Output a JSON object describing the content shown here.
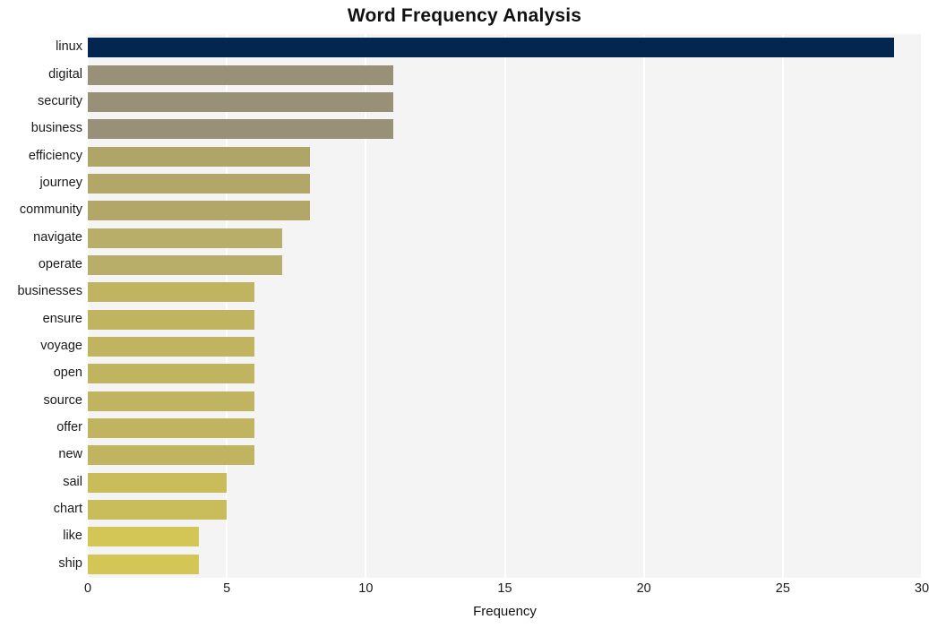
{
  "chart_data": {
    "type": "bar",
    "orientation": "horizontal",
    "title": "Word Frequency Analysis",
    "xlabel": "Frequency",
    "ylabel": "",
    "categories": [
      "linux",
      "digital",
      "security",
      "business",
      "efficiency",
      "journey",
      "community",
      "navigate",
      "operate",
      "businesses",
      "ensure",
      "voyage",
      "open",
      "source",
      "offer",
      "new",
      "sail",
      "chart",
      "like",
      "ship"
    ],
    "values": [
      29,
      11,
      11,
      11,
      8,
      8,
      8,
      7,
      7,
      6,
      6,
      6,
      6,
      6,
      6,
      6,
      5,
      5,
      4,
      4
    ],
    "bar_colors": [
      "#032650",
      "#999177",
      "#999177",
      "#999177",
      "#b0a568",
      "#b2a769",
      "#b2a769",
      "#b9ad6a",
      "#b9ad6a",
      "#c0b461",
      "#c0b461",
      "#c0b461",
      "#c0b461",
      "#c0b461",
      "#c0b461",
      "#c0b461",
      "#c9bc5b",
      "#c9bc5b",
      "#d4c557",
      "#d4c557"
    ],
    "xlim": [
      0,
      30
    ],
    "xticks": [
      0,
      5,
      10,
      15,
      20,
      25,
      30
    ],
    "xtick_labels": [
      "0",
      "5",
      "10",
      "15",
      "20",
      "25",
      "30"
    ],
    "grid": true,
    "grid_axis": "x",
    "grid_color": "#ffffff",
    "plot_background": "#f4f4f4",
    "figure_background": "#ffffff",
    "legend": null
  }
}
